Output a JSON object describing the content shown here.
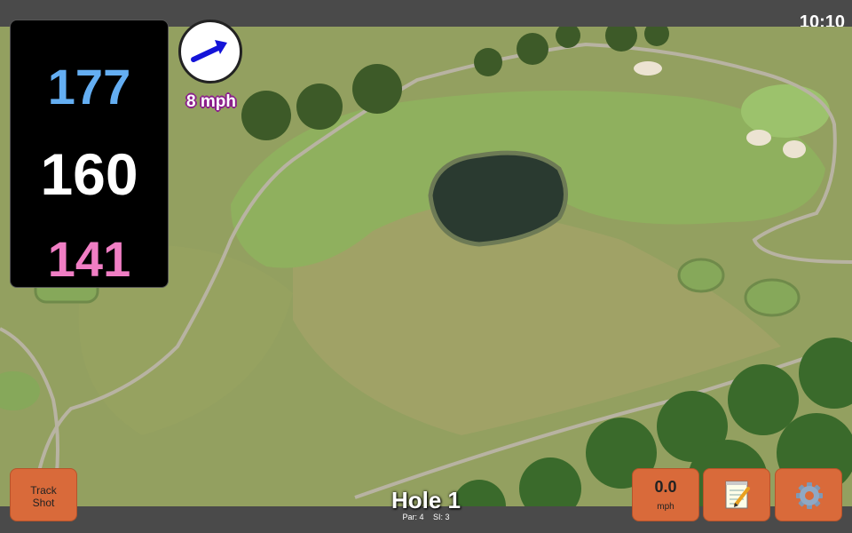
{
  "status_bar": {
    "time": "10:10"
  },
  "distances": {
    "back": "177",
    "middle": "160",
    "front": "141",
    "colors": {
      "back": "#64aef2",
      "middle": "#ffffff",
      "front": "#f07ec4"
    }
  },
  "wind": {
    "speed": "8 mph",
    "direction_icon": "arrow-up-right-icon",
    "arrow_color": "#1414d8"
  },
  "buttons": {
    "track_shot_line1": "Track",
    "track_shot_line2": "Shot",
    "speed_value": "0.0",
    "speed_unit": "mph",
    "notes_icon": "notepad-icon",
    "settings_icon": "gear-icon",
    "button_color": "#d96a3a"
  },
  "hole": {
    "title": "Hole 1",
    "par": "Par: 4",
    "si": "SI: 3"
  }
}
